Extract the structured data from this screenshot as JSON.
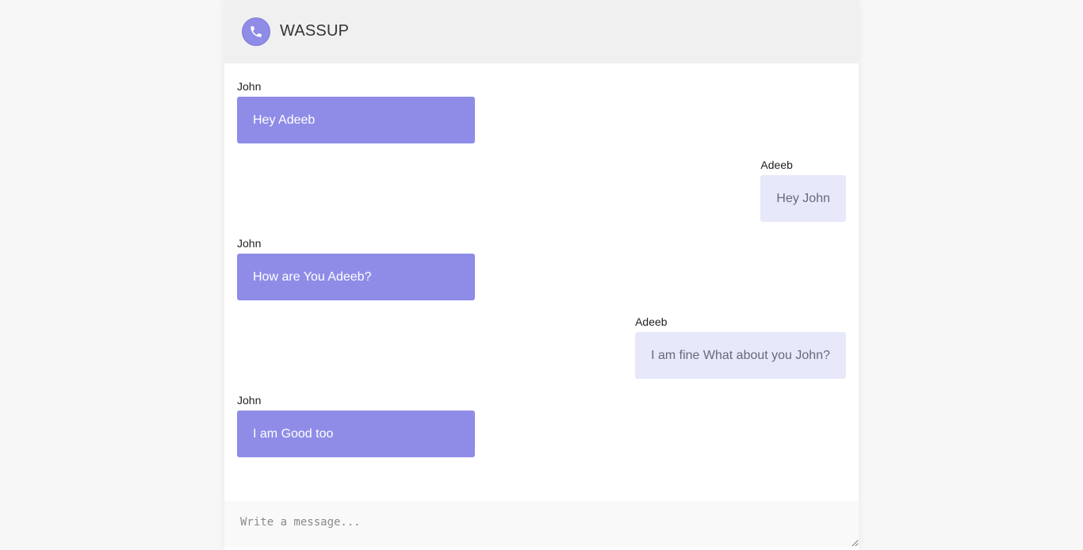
{
  "header": {
    "title": "WASSUP",
    "icon": "phone-icon",
    "accent": "#8f8ce8"
  },
  "messages": [
    {
      "sender": "John",
      "text": "Hey Adeeb",
      "direction": "incoming"
    },
    {
      "sender": "Adeeb",
      "text": "Hey John",
      "direction": "outgoing"
    },
    {
      "sender": "John",
      "text": "How are You Adeeb?",
      "direction": "incoming"
    },
    {
      "sender": "Adeeb",
      "text": "I am fine What about you John?",
      "direction": "outgoing"
    },
    {
      "sender": "John",
      "text": "I am Good too",
      "direction": "incoming"
    }
  ],
  "composer": {
    "placeholder": "Write a message...",
    "value": ""
  },
  "colors": {
    "incoming_bubble": "#8f8ce8",
    "outgoing_bubble": "#e8e8fb",
    "header_bg": "#f0f0f0"
  }
}
